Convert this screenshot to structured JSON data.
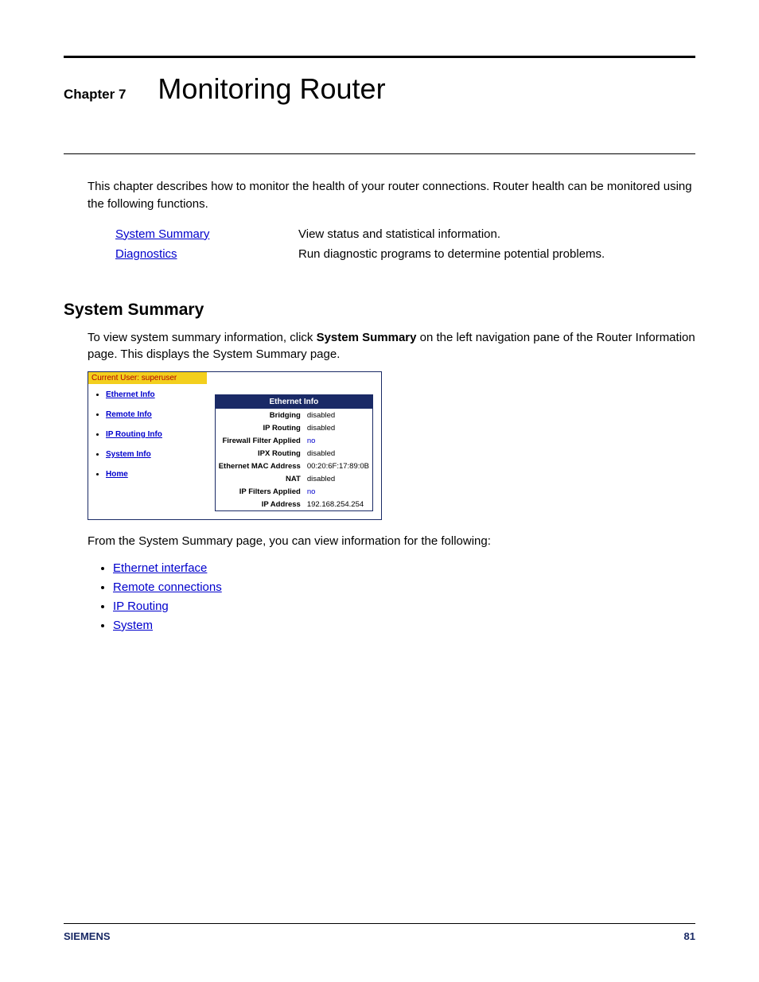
{
  "chapter": {
    "label": "Chapter 7",
    "title": "Monitoring Router"
  },
  "intro": "This chapter describes how to monitor the health of your router connections. Router health can be monitored using the following functions.",
  "functions": [
    {
      "link": "System Summary",
      "desc": "View status and statistical information."
    },
    {
      "link": "Diagnostics",
      "desc": "Run diagnostic programs to determine potential problems."
    }
  ],
  "section": {
    "heading": "System Summary",
    "para_pre": "To view system summary information, click ",
    "para_bold": "System Summary",
    "para_post": " on the left navigation pane of the Router Information page. This displays the System Summary page."
  },
  "screenshot": {
    "user_bar": "Current User: superuser",
    "nav_items": [
      "Ethernet Info",
      "Remote Info",
      "IP Routing Info",
      "System Info",
      "Home"
    ],
    "info_header": "Ethernet Info",
    "info_rows": [
      {
        "label": "Bridging",
        "value": "disabled",
        "link": false
      },
      {
        "label": "IP Routing",
        "value": "disabled",
        "link": false
      },
      {
        "label": "Firewall Filter Applied",
        "value": "no",
        "link": true
      },
      {
        "label": "IPX Routing",
        "value": "disabled",
        "link": false
      },
      {
        "label": "Ethernet MAC Address",
        "value": "00:20:6F:17:89:0B",
        "link": false
      },
      {
        "label": "NAT",
        "value": "disabled",
        "link": false
      },
      {
        "label": "IP Filters Applied",
        "value": "no",
        "link": true
      },
      {
        "label": "IP Address",
        "value": "192.168.254.254",
        "link": false
      }
    ]
  },
  "follow_text": "From the System Summary page, you can view information for the following:",
  "bullets": [
    "Ethernet interface",
    "Remote connections",
    "IP Routing",
    "System"
  ],
  "footer": {
    "brand": "SIEMENS",
    "page": "81"
  }
}
